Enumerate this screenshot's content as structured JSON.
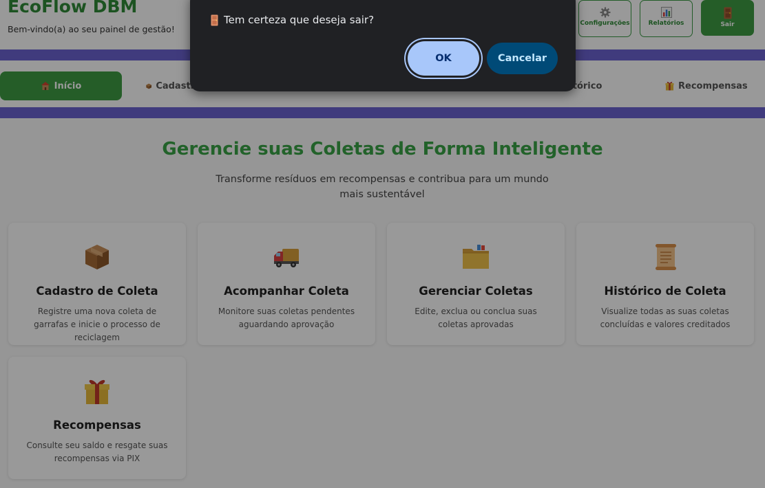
{
  "header": {
    "title": "EcoFlow DBM",
    "subtitle": "Bem-vindo(a) ao seu painel de gestão!",
    "buttons": {
      "settings": {
        "label": "Configurações",
        "icon": "gear-icon"
      },
      "reports": {
        "label": "Relatórios",
        "icon": "bar-chart-icon"
      },
      "exit": {
        "label": "Sair",
        "icon": "door-icon"
      }
    }
  },
  "nav": {
    "items": [
      {
        "label": "Início",
        "icon": "house-icon"
      },
      {
        "label": "Cadastro",
        "icon": "package-icon"
      },
      {
        "label": "stórico",
        "icon": "scroll-icon"
      },
      {
        "label": "Recompensas",
        "icon": "gift-icon"
      }
    ]
  },
  "hero": {
    "title": "Gerencie suas Coletas de Forma Inteligente",
    "subtitle": "Transforme resíduos em recompensas e contribua para um mundo mais sustentável"
  },
  "cards": [
    {
      "title": "Cadastro de Coleta",
      "description": "Registre uma nova coleta de garrafas e inicie o processo de reciclagem",
      "icon": "package-icon"
    },
    {
      "title": "Acompanhar Coleta",
      "description": "Monitore suas coletas pendentes aguardando aprovação",
      "icon": "truck-icon"
    },
    {
      "title": "Gerenciar Coletas",
      "description": "Edite, exclua ou conclua suas coletas aprovadas",
      "icon": "folder-icon"
    },
    {
      "title": "Histórico de Coleta",
      "description": "Visualize todas as suas coletas concluídas e valores creditados",
      "icon": "scroll-icon"
    },
    {
      "title": "Recompensas",
      "description": "Consulte seu saldo e resgate suas recompensas via PIX",
      "icon": "gift-icon"
    }
  ],
  "dialog": {
    "message": "Tem certeza que deseja sair?",
    "icon": "door-icon",
    "ok_label": "OK",
    "cancel_label": "Cancelar"
  },
  "colors": {
    "brand_green": "#3e9b43",
    "stripe_purple": "#6b63d0",
    "dialog_bg": "#202124",
    "ok_button": "#a8c7fa",
    "cancel_button": "#004a77"
  }
}
